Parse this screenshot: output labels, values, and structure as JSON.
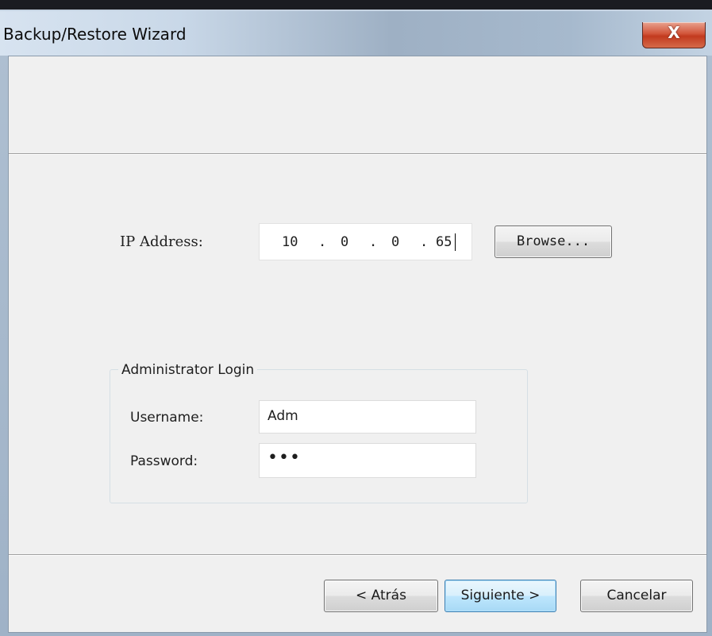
{
  "window": {
    "title": "Backup/Restore Wizard",
    "close_glyph": "X"
  },
  "ip": {
    "label": "IP Address:",
    "octets": [
      "10",
      "0",
      "0",
      "65"
    ],
    "dot": ".",
    "browse_label": "Browse..."
  },
  "login": {
    "group_title": "Administrator Login",
    "username_label": "Username:",
    "username_value": "Adm",
    "password_label": "Password:",
    "password_value": "•••"
  },
  "footer": {
    "back_label": "< Atrás",
    "next_label": "Siguiente >",
    "cancel_label": "Cancelar"
  },
  "colors": {
    "close_button": "#c9452a",
    "next_button_border": "#3c7fb1",
    "dialog_background": "#f0f0f0"
  }
}
